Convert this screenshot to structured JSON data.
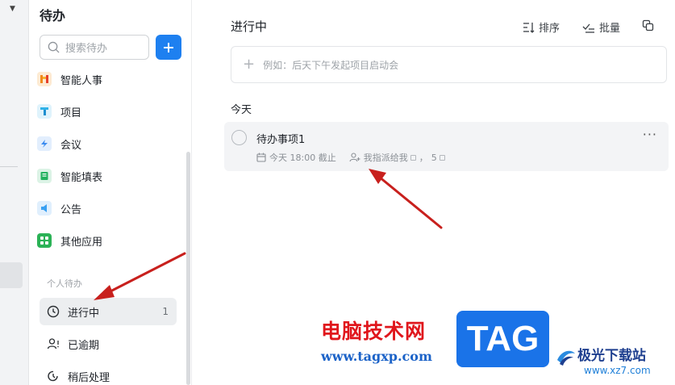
{
  "sidebar": {
    "title": "待办",
    "search_placeholder": "搜索待办",
    "apps": [
      {
        "label": "智能人事",
        "icon": "hr-app-icon",
        "color": "#f59a23"
      },
      {
        "label": "项目",
        "icon": "project-app-icon",
        "color": "#2fb1e8"
      },
      {
        "label": "会议",
        "icon": "meeting-app-icon",
        "color": "#3b8cf0"
      },
      {
        "label": "智能填表",
        "icon": "form-app-icon",
        "color": "#22b15f"
      },
      {
        "label": "公告",
        "icon": "announcement-app-icon",
        "color": "#3aa0f2"
      },
      {
        "label": "其他应用",
        "icon": "apps-grid-icon",
        "color": "#2bb256"
      }
    ],
    "group_label": "个人待办",
    "todo_items": [
      {
        "label": "进行中",
        "count": "1",
        "icon": "clock-icon"
      },
      {
        "label": "已逾期",
        "count": "",
        "icon": "user-alert-icon"
      },
      {
        "label": "稍后处理",
        "count": "",
        "icon": "later-icon"
      }
    ]
  },
  "main": {
    "title": "进行中",
    "toolbar": {
      "sort_label": "排序",
      "batch_label": "批量"
    },
    "quick_add_placeholder": "例如：后天下午发起项目启动会",
    "section_label": "今天",
    "task": {
      "title": "待办事项1",
      "due": "今天 18:00 截止",
      "assign": "我指派给我",
      "sep": "，",
      "count": "5"
    }
  },
  "watermark": {
    "site_name": "电脑技术网",
    "site_url": "www.tagxp.com",
    "logo_text": "TAG",
    "site2_name": "极光下载站",
    "site2_url": "www.xz7.com"
  },
  "colors": {
    "accent": "#1e80f0",
    "annotation_arrow": "#c8201d"
  }
}
